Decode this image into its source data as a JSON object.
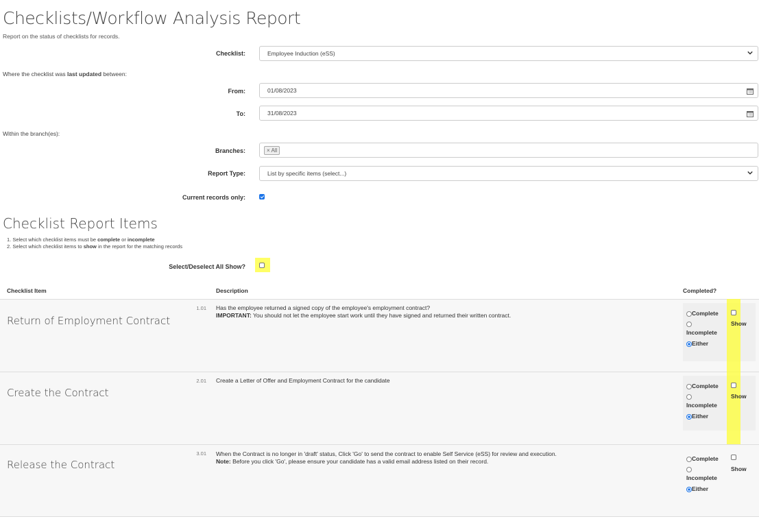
{
  "page": {
    "title": "Checklists/Workflow Analysis Report",
    "subtitle": "Report on the status of checklists for records."
  },
  "form": {
    "checklist_label": "Checklist:",
    "checklist_value": "Employee Induction (eSS)",
    "updated_prefix": "Where the checklist was ",
    "updated_bold": "last updated",
    "updated_suffix": " between:",
    "from_label": "From:",
    "from_value": "01/08/2023",
    "to_label": "To:",
    "to_value": "31/08/2023",
    "branch_intro": "Within the branch(es):",
    "branches_label": "Branches:",
    "branches_tag": "× All",
    "report_type_label": "Report Type:",
    "report_type_value": "List by specific items (select...)",
    "current_label": "Current records only:",
    "current_checked": true
  },
  "items_section": {
    "heading": "Checklist Report Items",
    "step1_a": "1. Select which checklist items must be ",
    "step1_b": "complete",
    "step1_c": " or ",
    "step1_d": "incomplete",
    "step2_a": "2. Select which checklist items to ",
    "step2_b": "show",
    "step2_c": " in the report for the matching records",
    "select_all_label": "Select/Deselect All Show?",
    "col_item": "Checklist Item",
    "col_desc": "Description",
    "col_completed": "Completed?"
  },
  "options": {
    "complete": "Complete",
    "incomplete": "Incomplete",
    "either": "Either",
    "show": "Show"
  },
  "rows": [
    {
      "title": "Return of Employment Contract",
      "num": "1.01",
      "line1": "Has the employee returned a signed copy of the employee's employment contract?",
      "line2_bold": "IMPORTANT:",
      "line2": " You should not let the employee start work until they have signed and returned their written contract."
    },
    {
      "title": "Create the Contract",
      "num": "2.01",
      "line1": "Create a Letter of Offer and Employment Contract for the candidate",
      "line2_bold": "",
      "line2": ""
    },
    {
      "title": "Release the Contract",
      "num": "3.01",
      "line1": "When the Contract is no longer in 'draft' status, Click 'Go' to send the contract to enable Self Service (eSS) for review and execution.",
      "line2_bold": "Note:",
      "line2": " Before you click 'Go', please ensure your candidate has a valid email address listed on their record."
    }
  ],
  "colors": {
    "accent": "#1a73e8",
    "highlight": "#ffff33",
    "row_bg": "#f7f7f7"
  }
}
